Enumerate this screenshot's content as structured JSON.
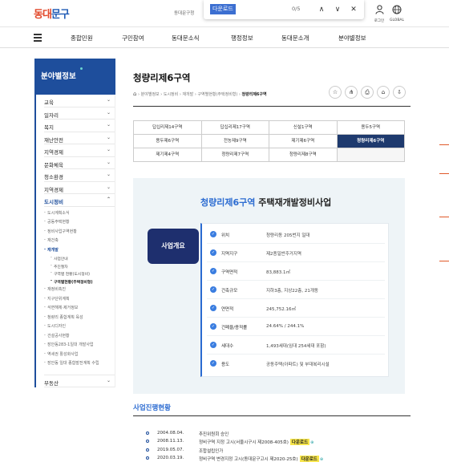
{
  "header": {
    "logo_a": "동대",
    "logo_b": "문구",
    "site_sub": "동대문구청",
    "find": {
      "query": "다운로드",
      "count": "0/5",
      "up": "∧",
      "down": "∨",
      "close": "✕"
    },
    "login_label": "로그인",
    "global_label": "GLOBAL"
  },
  "nav": [
    "종합민원",
    "구민참여",
    "동대문소식",
    "행정정보",
    "동대문소개",
    "분야별정보"
  ],
  "sidebar": {
    "title": "분야별정보",
    "items": [
      {
        "label": "교육"
      },
      {
        "label": "일자리"
      },
      {
        "label": "복지"
      },
      {
        "label": "재난안전"
      },
      {
        "label": "지역경제"
      },
      {
        "label": "문화체육"
      },
      {
        "label": "청소환경"
      },
      {
        "label": "지역경제"
      },
      {
        "label": "도시정비"
      }
    ],
    "sub_items": [
      "도시계획소식",
      "공동주택현황",
      "정비사업구역현황",
      "재건축",
      "재개발"
    ],
    "subsub_items": [
      "사업안내",
      "추진절차",
      "구역별 현황(도시정비)",
      "구역별현황(주택정비형)"
    ],
    "sub_items_2": [
      "재정비촉진",
      "지구단위계획",
      "석면해체·제거정보",
      "청량리 종합계획 육성",
      "도시디자인",
      "건설공사현황",
      "장안동283-1일대 개발사업",
      "역세권 활성화사업",
      "장안동 일대 종합발전계획 수립"
    ],
    "last_item": "부동산"
  },
  "page": {
    "title": "청량리제6구역",
    "breadcrumb": [
      "분야별정보",
      "도시정비",
      "재개발",
      "구역별현황(주택정비형)",
      "청량리제6구역"
    ],
    "util_icons": [
      "☆",
      "⋔",
      "⎙",
      "⌂",
      "⇩"
    ]
  },
  "tabs": [
    "답십리제14구역",
    "답십리제17구역",
    "신설1구역",
    "용두5구역",
    "용두제6구역",
    "전농제9구역",
    "제기제6구역",
    "청량리제6구역",
    "제기제4구역",
    "청량리제7구역",
    "청량리제8구역",
    ""
  ],
  "active_tab": "청량리제6구역",
  "overview": {
    "title_hl": "청량리제6구역",
    "title_rest": " 주택재개발정비사업",
    "badge": "사업개요",
    "rows": [
      {
        "k": "위치",
        "v": "청량리동 205번지 일대"
      },
      {
        "k": "지역지구",
        "v": "제2종일반주거지역"
      },
      {
        "k": "구역면적",
        "v": "83,883.1㎡"
      },
      {
        "k": "건축규모",
        "v": "지하3층, 지상22층, 21개동"
      },
      {
        "k": "연면적",
        "v": "245,752.16㎡"
      },
      {
        "k": "건폐율/용적률",
        "v": "24.64% / 244.1%"
      },
      {
        "k": "세대수",
        "v": "1,493세대(임대 254세대 포함)"
      },
      {
        "k": "용도",
        "v": "공동주택(아파트) 및 부대복리시설"
      }
    ]
  },
  "progress": {
    "title": "사업진행현황",
    "download": "다운로드",
    "rows": [
      {
        "date": "2004.08.04.",
        "desc": "추진위원회 승인",
        "dl": false
      },
      {
        "date": "2008.11.13.",
        "desc": "정비구역 지정 고시(서울시구시 제2008-405호)",
        "dl": true
      },
      {
        "date": "2019.05.07.",
        "desc": "조합설립인가",
        "dl": false
      },
      {
        "date": "2020.03.19.",
        "desc": "정비구역 변경지정 고시(동대문구고시 제2020-25호)",
        "dl": true
      }
    ]
  },
  "colors": {
    "brand": "#1e4e9c",
    "accent": "#2b6bd1",
    "active_tab": "#1e3a6e",
    "download_bg": "#f7e54a"
  }
}
